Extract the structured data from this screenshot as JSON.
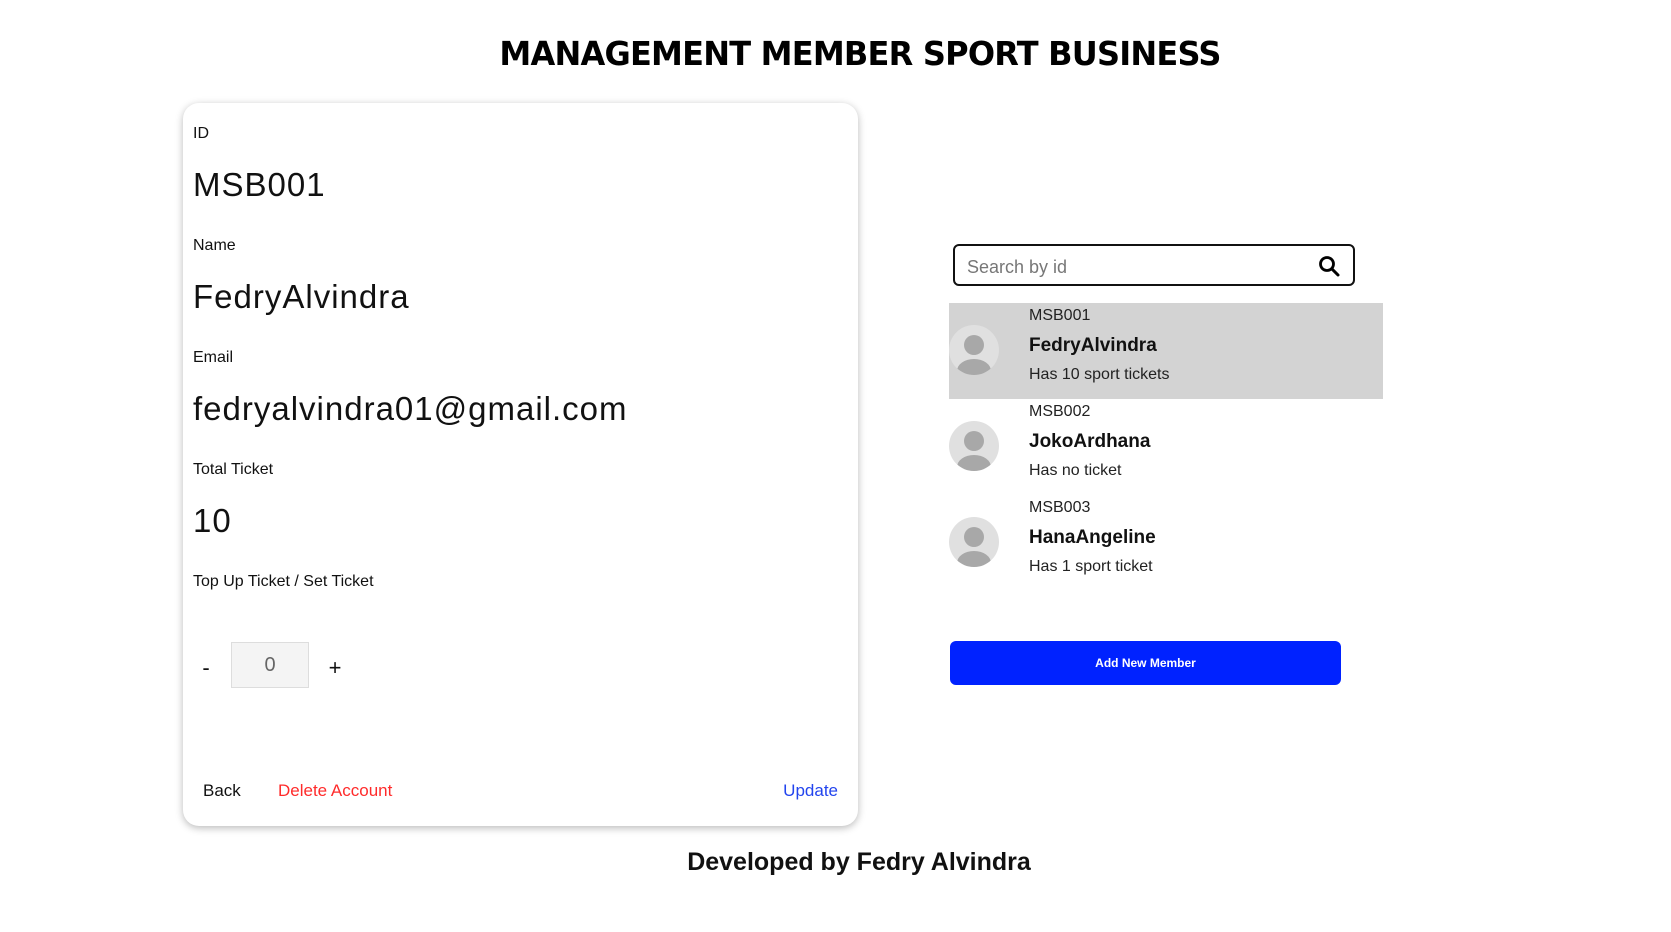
{
  "header": {
    "title": "MANAGEMENT MEMBER SPORT BUSINESS"
  },
  "detail": {
    "id_label": "ID",
    "id_value": "MSB001",
    "name_label": "Name",
    "name_value": "FedryAlvindra",
    "email_label": "Email",
    "email_value": "fedryalvindra01@gmail.com",
    "total_label": "Total Ticket",
    "total_value": "10",
    "topup_label": "Top Up Ticket / Set Ticket",
    "decrement_label": "-",
    "stepper_value": "0",
    "increment_label": "+",
    "back_label": "Back",
    "delete_label": "Delete Account",
    "update_label": "Update"
  },
  "search": {
    "placeholder": "Search by id",
    "value": ""
  },
  "members": [
    {
      "id": "MSB001",
      "name": "FedryAlvindra",
      "tickets": "Has 10 sport tickets",
      "selected": true
    },
    {
      "id": "MSB002",
      "name": "JokoArdhana",
      "tickets": "Has no ticket",
      "selected": false
    },
    {
      "id": "MSB003",
      "name": "HanaAngeline",
      "tickets": "Has 1 sport ticket",
      "selected": false
    }
  ],
  "add_button_label": "Add New Member",
  "footer": {
    "text": "Developed by Fedry Alvindra"
  },
  "colors": {
    "accent": "#0022ff",
    "danger": "#ff2b2b",
    "link": "#2244ee",
    "selected_row": "#d3d3d3"
  },
  "icons": {
    "search": "search-icon",
    "avatar": "user-avatar-icon"
  }
}
